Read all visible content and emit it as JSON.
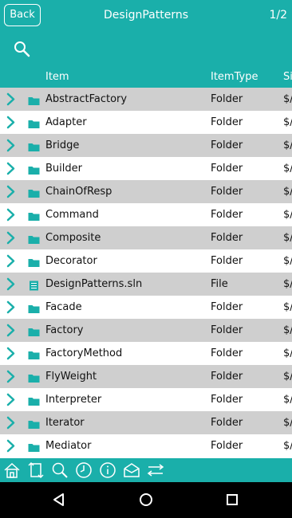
{
  "header": {
    "back_label": "Back",
    "title": "DesignPatterns",
    "pager": "1/2",
    "search_icon": "search-icon"
  },
  "columns": {
    "item": "Item",
    "itemtype": "ItemType",
    "size": "Si"
  },
  "rows": [
    {
      "name": "AbstractFactory",
      "type": "Folder",
      "size": "$/",
      "icon": "folder-icon"
    },
    {
      "name": "Adapter",
      "type": "Folder",
      "size": "$/",
      "icon": "folder-icon"
    },
    {
      "name": "Bridge",
      "type": "Folder",
      "size": "$/",
      "icon": "folder-icon"
    },
    {
      "name": "Builder",
      "type": "Folder",
      "size": "$/",
      "icon": "folder-icon"
    },
    {
      "name": "ChainOfResp",
      "type": "Folder",
      "size": "$/",
      "icon": "folder-icon"
    },
    {
      "name": "Command",
      "type": "Folder",
      "size": "$/",
      "icon": "folder-icon"
    },
    {
      "name": "Composite",
      "type": "Folder",
      "size": "$/",
      "icon": "folder-icon"
    },
    {
      "name": "Decorator",
      "type": "Folder",
      "size": "$/",
      "icon": "folder-icon"
    },
    {
      "name": "DesignPatterns.sln",
      "type": "File",
      "size": "$/",
      "icon": "file-icon"
    },
    {
      "name": "Facade",
      "type": "Folder",
      "size": "$/",
      "icon": "folder-icon"
    },
    {
      "name": "Factory",
      "type": "Folder",
      "size": "$/",
      "icon": "folder-icon"
    },
    {
      "name": "FactoryMethod",
      "type": "Folder",
      "size": "$/",
      "icon": "folder-icon"
    },
    {
      "name": "FlyWeight",
      "type": "Folder",
      "size": "$/",
      "icon": "folder-icon"
    },
    {
      "name": "Interpreter",
      "type": "Folder",
      "size": "$/",
      "icon": "folder-icon"
    },
    {
      "name": "Iterator",
      "type": "Folder",
      "size": "$/",
      "icon": "folder-icon"
    },
    {
      "name": "Mediator",
      "type": "Folder",
      "size": "$/",
      "icon": "folder-icon"
    }
  ],
  "toolbar": [
    "home-icon",
    "swap-icon",
    "search-icon",
    "clock-icon",
    "info-icon",
    "mail-open-icon",
    "sort-arrows-icon"
  ],
  "navbar": [
    "back-triangle-icon",
    "home-circle-icon",
    "recents-square-icon"
  ],
  "colors": {
    "accent": "#1aafaa",
    "row_alt": "#cfcfcf",
    "row_plain": "#ffffff",
    "navbar": "#000000"
  }
}
